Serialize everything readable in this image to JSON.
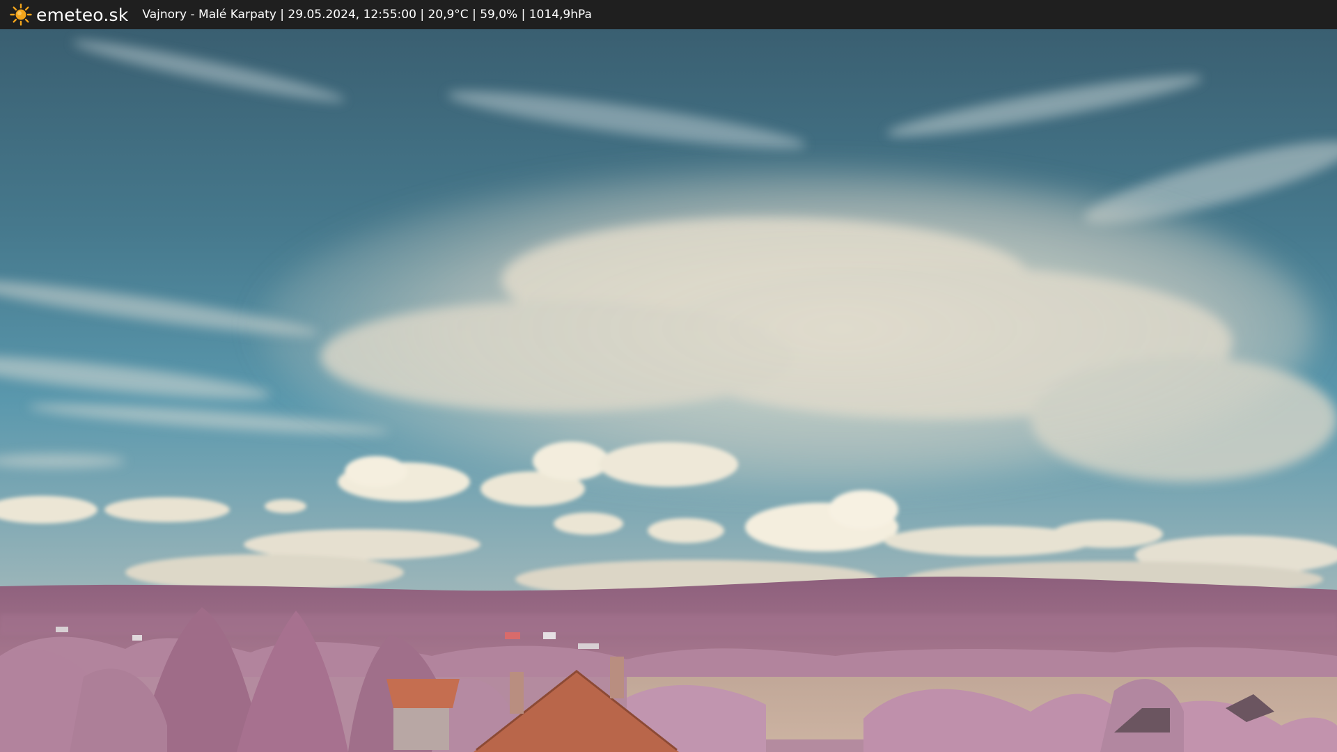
{
  "header": {
    "brand": "emeteo.sk",
    "brand_icon": "sun-icon",
    "info": "Vajnory - Malé Karpaty | 29.05.2024, 12:55:00 | 20,9°C | 59,0% | 1014,9hPa"
  },
  "colors": {
    "bar_background": "#1f1f1f",
    "sun": "#f3a51b",
    "sky_top": "#3f6678",
    "sky_mid": "#4f8ea3",
    "cloud": "#e6e0cf",
    "hills": "#9b6f8a",
    "foliage": "#b98aa5",
    "field": "#c4aa9a",
    "roof": "#c26c4e"
  }
}
